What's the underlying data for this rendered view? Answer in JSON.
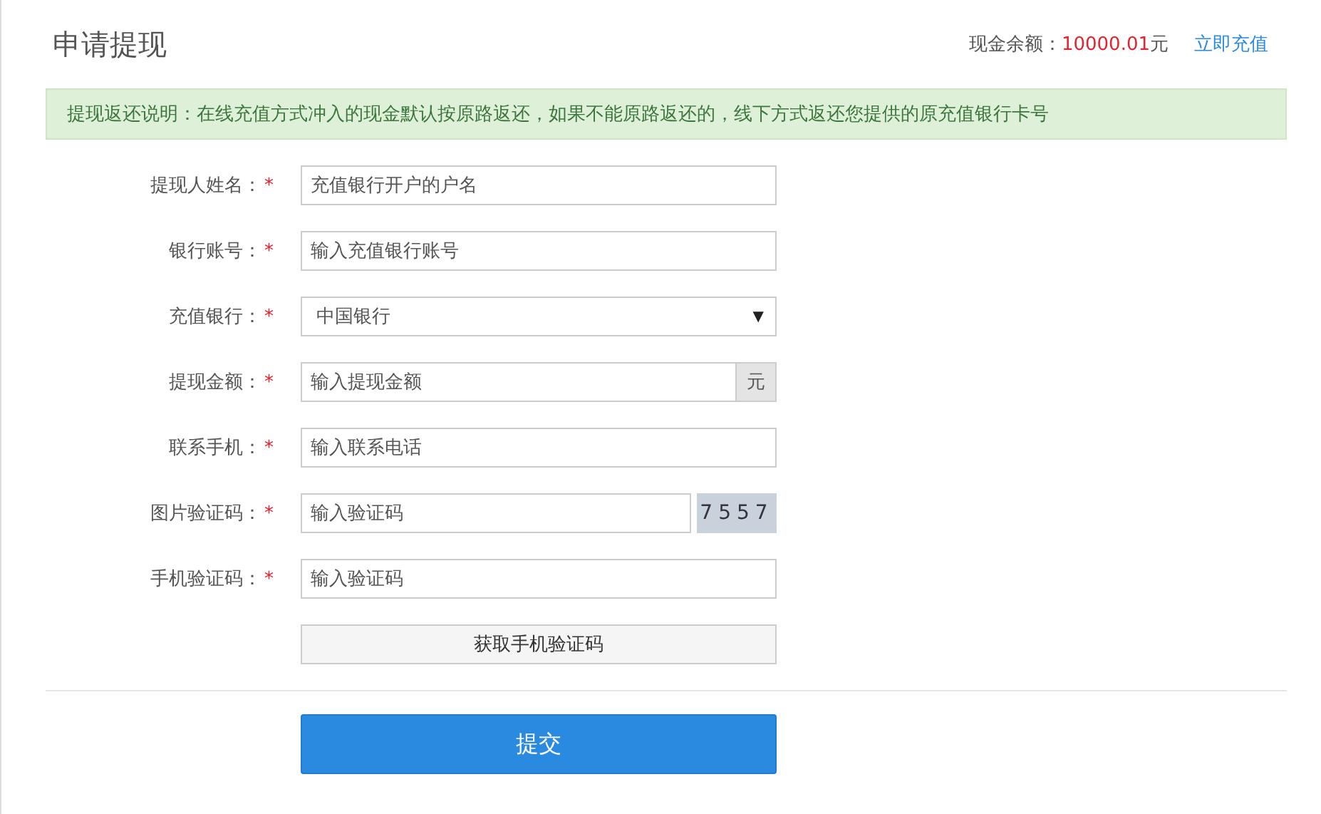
{
  "header": {
    "title": "申请提现",
    "balance_label": "现金余额：",
    "balance_value": "10000.01",
    "balance_unit": "元",
    "recharge_link": "立即充值"
  },
  "notice": "提现返还说明：在线充值方式冲入的现金默认按原路返还，如果不能原路返还的，线下方式返还您提供的原充值银行卡号",
  "fields": [
    {
      "kind": "text",
      "label": "提现人姓名：",
      "mark": "*",
      "placeholder": "充值银行开户的户名"
    },
    {
      "kind": "text",
      "label": "银行账号：",
      "mark": "*",
      "placeholder": "输入充值银行账号"
    },
    {
      "kind": "select",
      "label": "充值银行：",
      "mark": "*",
      "value": "中国银行",
      "arrow": "▼"
    },
    {
      "kind": "addon",
      "label": "提现金额：",
      "mark": "*",
      "placeholder": "输入提现金额",
      "addon": "元"
    },
    {
      "kind": "text",
      "label": "联系手机：",
      "mark": "*",
      "placeholder": "输入联系电话"
    },
    {
      "kind": "captcha",
      "label": "图片验证码：",
      "mark": "*",
      "placeholder": "输入验证码",
      "captcha": "7557"
    },
    {
      "kind": "text",
      "label": "手机验证码：",
      "mark": "*",
      "placeholder": "输入验证码"
    }
  ],
  "sms_button": "获取手机验证码",
  "submit_button": "提交"
}
